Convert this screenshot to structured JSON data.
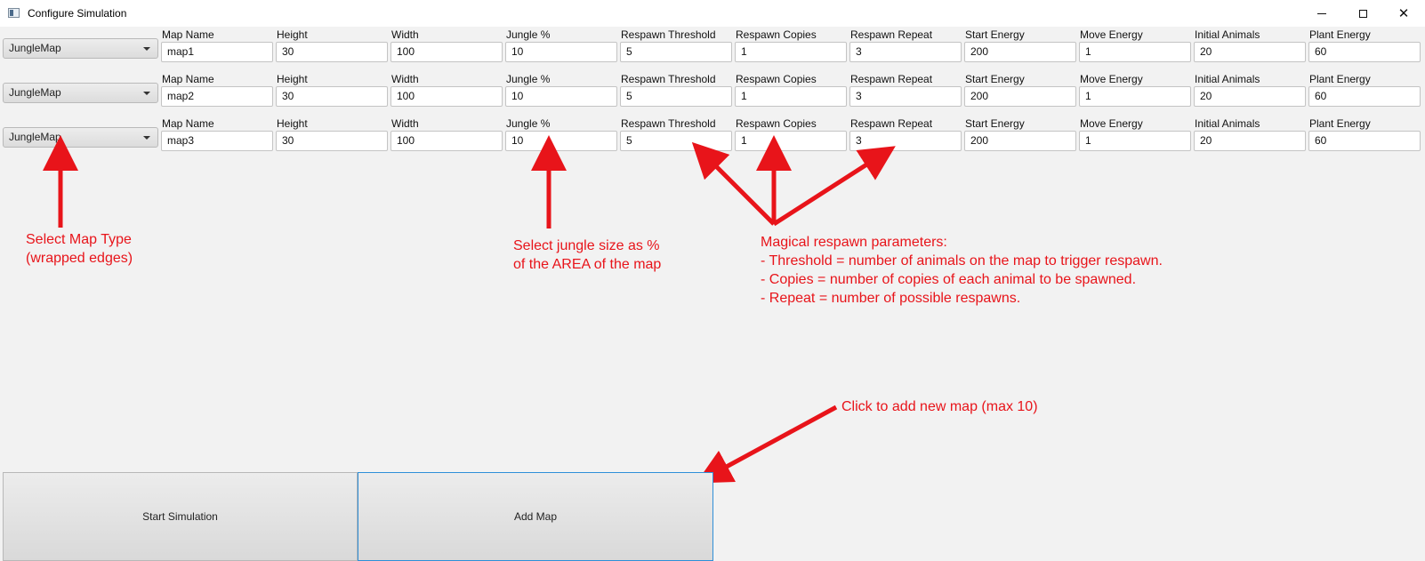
{
  "window": {
    "title": "Configure Simulation",
    "controls": {
      "minimize": "—",
      "maximize": "☐",
      "close": "✕"
    }
  },
  "field_labels": [
    "Map Name",
    "Height",
    "Width",
    "Jungle %",
    "Respawn Threshold",
    "Respawn Copies",
    "Respawn Repeat",
    "Start Energy",
    "Move Energy",
    "Initial Animals",
    "Plant Energy"
  ],
  "maps": [
    {
      "type": "JungleMap",
      "values": [
        "map1",
        "30",
        "100",
        "10",
        "5",
        "1",
        "3",
        "200",
        "1",
        "20",
        "60"
      ]
    },
    {
      "type": "JungleMap",
      "values": [
        "map2",
        "30",
        "100",
        "10",
        "5",
        "1",
        "3",
        "200",
        "1",
        "20",
        "60"
      ]
    },
    {
      "type": "JungleMap",
      "values": [
        "map3",
        "30",
        "100",
        "10",
        "5",
        "1",
        "3",
        "200",
        "1",
        "20",
        "60"
      ]
    }
  ],
  "annotations": {
    "map_type": "Select Map Type\n(wrapped edges)",
    "jungle": "Select jungle size as %\nof the AREA of the map",
    "respawn": "Magical respawn parameters:\n- Threshold = number of animals on the map to trigger respawn.\n- Copies = number of copies of each animal to be spawned.\n- Repeat = number of possible respawns.",
    "add_map": "Click to add new map (max 10)",
    "color": "#e8141a"
  },
  "buttons": {
    "start": "Start Simulation",
    "add": "Add Map"
  }
}
